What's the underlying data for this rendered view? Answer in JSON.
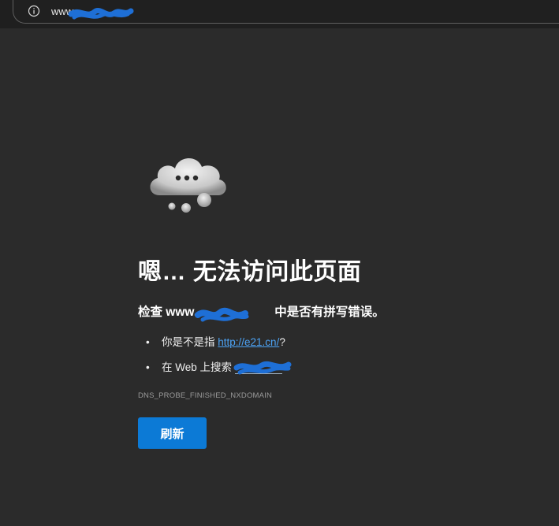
{
  "browser": {
    "url_visible": "www.",
    "info_icon": "info-icon"
  },
  "error_page": {
    "icon": "cloud-icon",
    "title": "嗯… 无法访问此页面",
    "check_prefix": "检查 www.",
    "check_suffix": "中是否有拼写错误。",
    "suggestions": {
      "did_you_mean_prefix": "你是不是指 ",
      "did_you_mean_link": "http://e21.cn/",
      "did_you_mean_suffix": "?",
      "search_prefix": "在 Web 上搜索 "
    },
    "bullet": "•",
    "error_code": "DNS_PROBE_FINISHED_NXDOMAIN",
    "refresh_label": "刷新"
  },
  "colors": {
    "background": "#2b2b2b",
    "link": "#4ca3f5",
    "button": "#0c7ad6",
    "redaction": "#1e6fd6"
  }
}
